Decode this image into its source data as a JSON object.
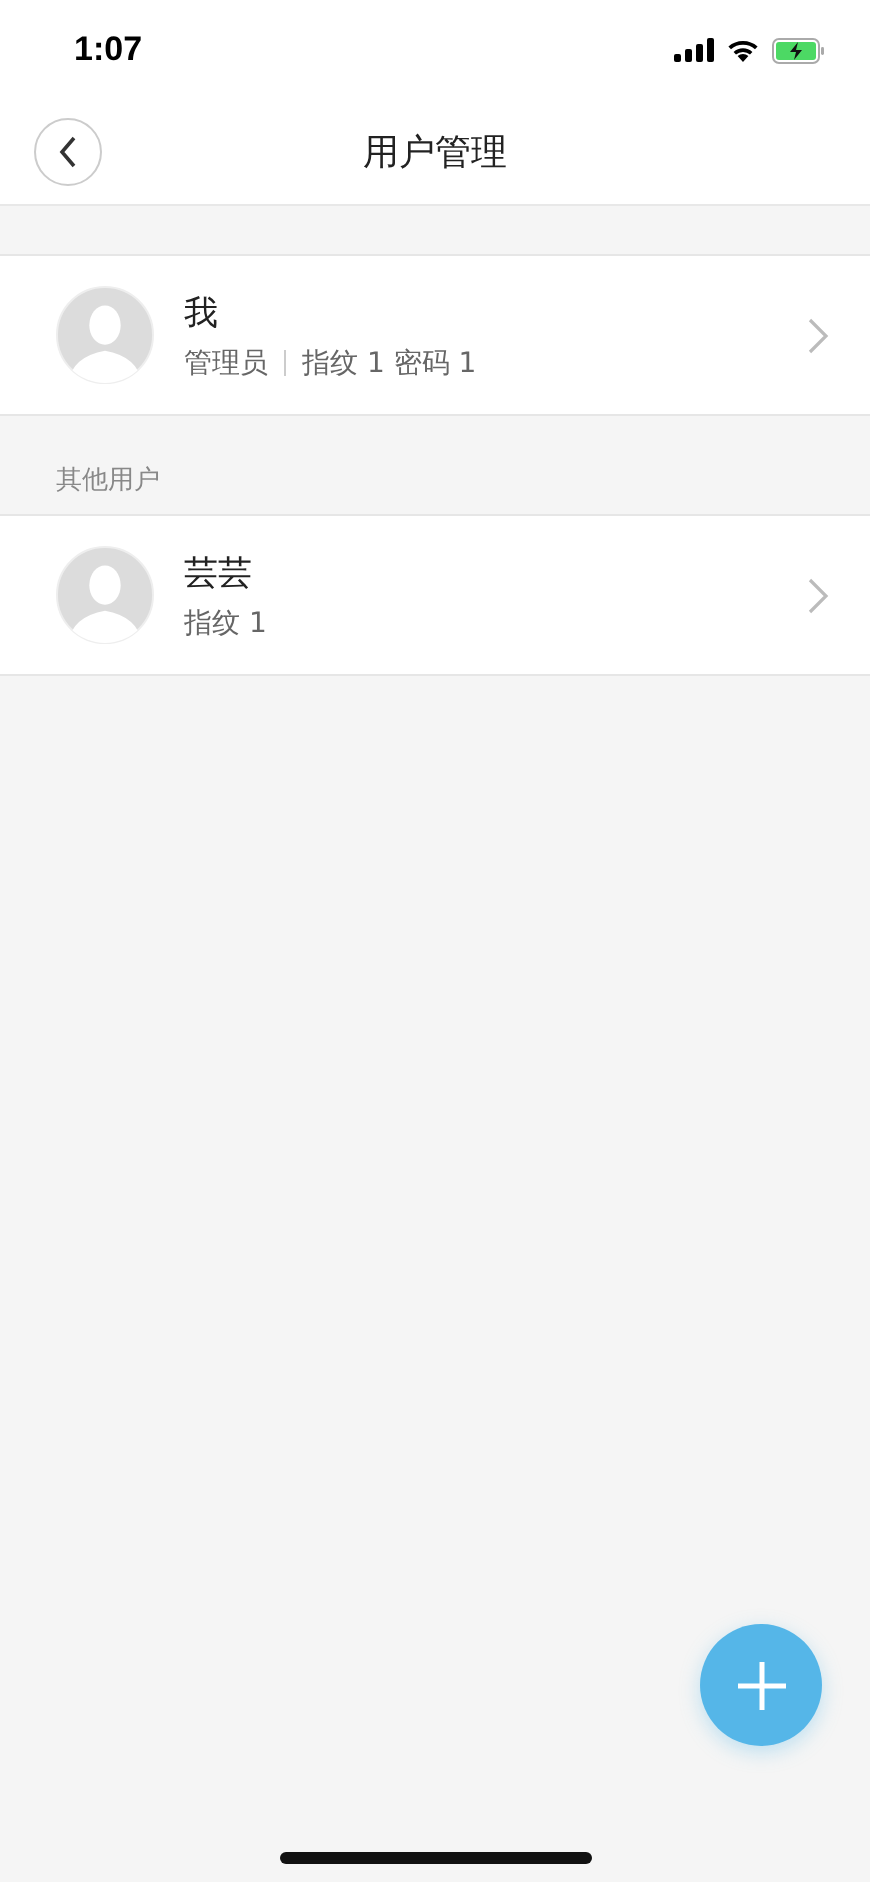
{
  "status_bar": {
    "time": "1:07"
  },
  "nav": {
    "title": "用户管理"
  },
  "sections": [
    {
      "users": [
        {
          "name": "我",
          "details": [
            "管理员",
            "指纹 1 密码 1"
          ]
        }
      ]
    },
    {
      "header": "其他用户",
      "users": [
        {
          "name": "芸芸",
          "details": [
            "指纹 1"
          ]
        }
      ]
    }
  ]
}
